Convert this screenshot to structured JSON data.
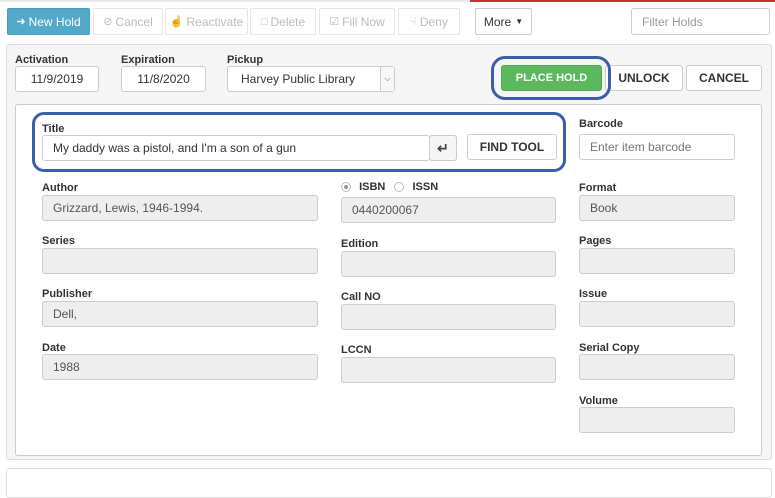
{
  "toolbar": {
    "new_hold": "New Hold",
    "cancel": "Cancel",
    "reactivate": "Reactivate",
    "delete": "Delete",
    "fill_now": "Fill Now",
    "deny": "Deny",
    "more": "More",
    "filter_placeholder": "Filter Holds"
  },
  "hold": {
    "activation_label": "Activation",
    "activation_value": "11/9/2019",
    "expiration_label": "Expiration",
    "expiration_value": "11/8/2020",
    "pickup_label": "Pickup",
    "pickup_value": "Harvey Public Library",
    "place_hold": "PLACE HOLD",
    "unlock": "UNLOCK",
    "cancel": "CANCEL"
  },
  "item": {
    "title_label": "Title",
    "title_value": "My daddy was a pistol, and I'm a son of a gun",
    "find_tool": "FIND TOOL",
    "barcode_label": "Barcode",
    "barcode_placeholder": "Enter item barcode",
    "author_label": "Author",
    "author_value": "Grizzard, Lewis, 1946-1994.",
    "isbn_label": "ISBN",
    "issn_label": "ISSN",
    "isbn_value": "0440200067",
    "format_label": "Format",
    "format_value": "Book",
    "series_label": "Series",
    "series_value": "",
    "edition_label": "Edition",
    "edition_value": "",
    "pages_label": "Pages",
    "pages_value": "",
    "publisher_label": "Publisher",
    "publisher_value": "Dell,",
    "callno_label": "Call NO",
    "callno_value": "",
    "issue_label": "Issue",
    "issue_value": "",
    "date_label": "Date",
    "date_value": "1988",
    "lccn_label": "LCCN",
    "lccn_value": "",
    "serial_copy_label": "Serial Copy",
    "serial_copy_value": "",
    "volume_label": "Volume",
    "volume_value": ""
  },
  "colors": {
    "primary": "#52a9c8",
    "success": "#5cb85c",
    "highlight": "#3b5ea8"
  }
}
